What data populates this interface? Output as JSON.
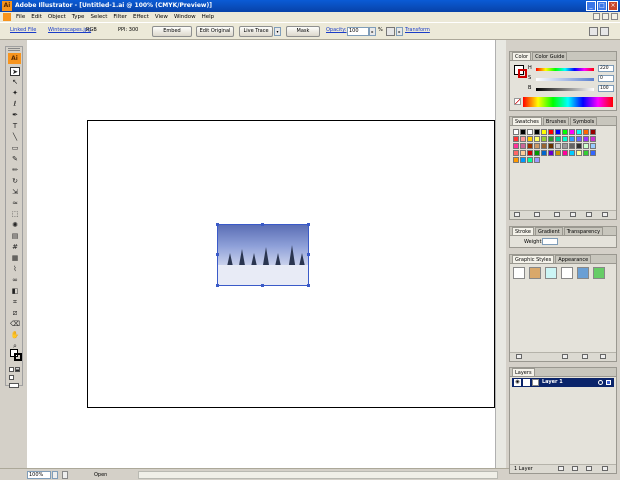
{
  "window": {
    "title": "Adobe Illustrator - [Untitled-1.ai @ 100% (CMYK/Preview)]",
    "app_badge": "Ai",
    "minimize": "_",
    "maximize": "□",
    "close": "×"
  },
  "menu": [
    "File",
    "Edit",
    "Object",
    "Type",
    "Select",
    "Filter",
    "Effect",
    "View",
    "Window",
    "Help"
  ],
  "controlbar": {
    "linked_file": "Linked File",
    "filename": "Winterscapes.jpg",
    "color_mode": "RGB",
    "ppi": "PPI: 300",
    "embed": "Embed",
    "edit_original": "Edit Original",
    "live_trace": "Live Trace",
    "mask": "Mask",
    "opacity_label": "Opacity:",
    "opacity_value": "100",
    "percent": "%",
    "transform": "Transform"
  },
  "status": {
    "zoom": "100%",
    "state": "Open"
  },
  "color_panel": {
    "tabs": [
      "Color",
      "Color Guide"
    ],
    "channels": [
      {
        "label": "H",
        "value": "220",
        "color": "#5a7fd0"
      },
      {
        "label": "S",
        "value": "0",
        "color": "#e0e0e0"
      },
      {
        "label": "B",
        "value": "100",
        "color": "#000000"
      }
    ]
  },
  "swatches_panel": {
    "tabs": [
      "Swatches",
      "Brushes",
      "Symbols"
    ],
    "colors": [
      "#ffffff",
      "#000000",
      "#ffffff",
      "#000000",
      "#ffff00",
      "#ff0000",
      "#0000ff",
      "#00ff00",
      "#ff00ff",
      "#00ffff",
      "#ff6600",
      "#990000",
      "#ff3333",
      "#ff9999",
      "#ffcc00",
      "#ffff66",
      "#99cc33",
      "#339933",
      "#00cc99",
      "#00ffcc",
      "#3399ff",
      "#6666ff",
      "#9933ff",
      "#cc33cc",
      "#ff3399",
      "#cc6699",
      "#993300",
      "#cc9966",
      "#996633",
      "#663300",
      "#cccccc",
      "#999999",
      "#666666",
      "#333333",
      "#ccffcc",
      "#99ccff",
      "#ff6666",
      "#ffcc99",
      "#cc0000",
      "#009900",
      "#0066cc",
      "#6600cc",
      "#cc9900",
      "#ff0099",
      "#00ccff",
      "#ffff99",
      "#33cc33",
      "#3366ff",
      "#ff9900",
      "#0099ff",
      "#00ff99",
      "#9999ff"
    ]
  },
  "stroke_panel": {
    "tabs": [
      "Stroke",
      "Gradient",
      "Transparency"
    ],
    "weight_label": "Weight:"
  },
  "graphic_styles_panel": {
    "tabs": [
      "Graphic Styles",
      "Appearance"
    ],
    "styles": [
      "#ffffff",
      "#d9a86a",
      "#ccf5f5",
      "#ffffff",
      "#6a9fd4",
      "#66cc66"
    ]
  },
  "layers_panel": {
    "tabs": [
      "Layers"
    ],
    "layer_name": "Layer 1",
    "footer_count": "1 Layer"
  }
}
